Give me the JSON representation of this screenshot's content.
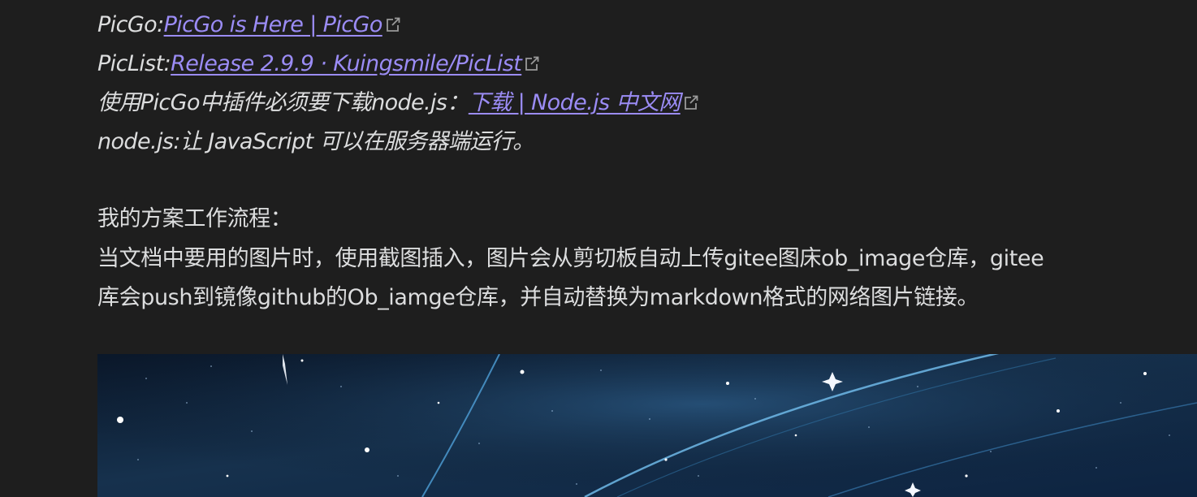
{
  "note": {
    "links_block": [
      {
        "prefix": "PicGo:",
        "link_text": "PicGo is Here | PicGo",
        "icon": "external-link-icon"
      },
      {
        "prefix": "PicList:",
        "link_text": "Release 2.9.9 · Kuingsmile/PicList",
        "icon": "external-link-icon"
      },
      {
        "prefix": "使用PicGo中插件必须要下载node.js：",
        "link_text": "下载 | Node.js 中文网",
        "icon": "external-link-icon"
      }
    ],
    "nodejs_note": "node.js:让 JavaScript 可以在服务器端运行。",
    "workflow_heading": "我的方案工作流程：",
    "workflow_line1": "当文档中要用的图片时，使用截图插入，图片会从剪切板自动上传gitee图床ob_image仓库，gitee",
    "workflow_line2": "库会push到镜像github的Ob_iamge仓库，并自动替换为markdown格式的网络图片链接。",
    "embedded_image": {
      "subject": "starry-night-sky",
      "colors": {
        "sky_dark": "#07121f",
        "sky_mid": "#16314d",
        "streak": "#4fa0d8"
      }
    }
  },
  "colors": {
    "background": "#1e1e1e",
    "text": "#dcddde",
    "link": "#9b8cf5"
  }
}
